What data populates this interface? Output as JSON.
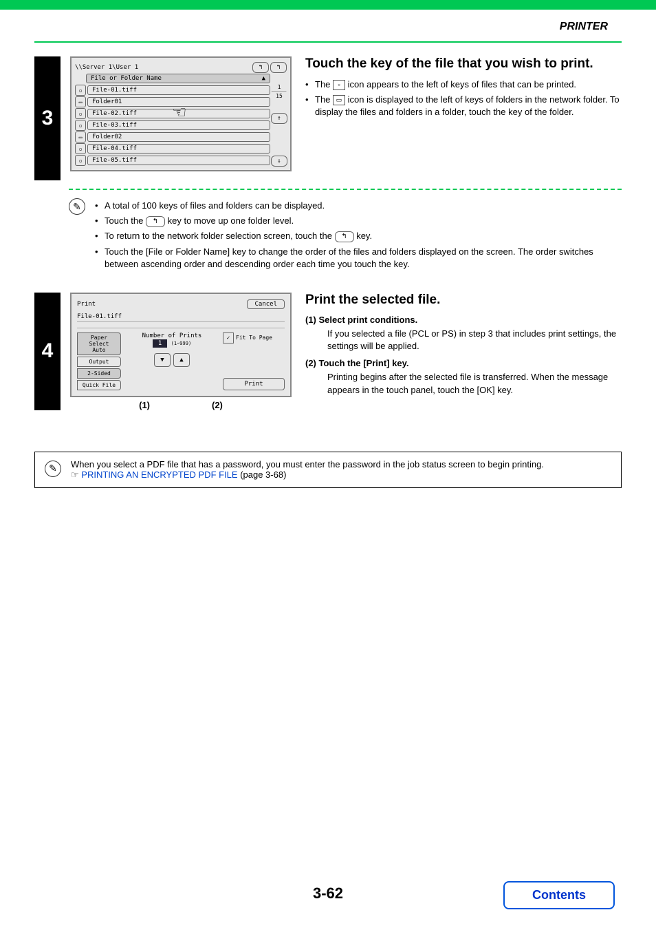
{
  "header": {
    "title": "PRINTER"
  },
  "step3": {
    "number": "3",
    "panel": {
      "path": "\\\\Server 1\\User 1",
      "sort_header": "File or Folder Name",
      "items": [
        {
          "type": "file",
          "name": "File-01.tiff"
        },
        {
          "type": "folder",
          "name": "Folder01"
        },
        {
          "type": "file",
          "name": "File-02.tiff"
        },
        {
          "type": "file",
          "name": "File-03.tiff"
        },
        {
          "type": "folder",
          "name": "Folder02"
        },
        {
          "type": "file",
          "name": "File-04.tiff"
        },
        {
          "type": "file",
          "name": "File-05.tiff"
        }
      ],
      "page_current": "1",
      "page_total": "15"
    },
    "title": "Touch the key of the file that you wish to print.",
    "bullets": [
      {
        "prefix": "The ",
        "mid": " icon appears to the left of keys of files that can be printed."
      },
      {
        "prefix": "The ",
        "mid": " icon is displayed to the left of keys of folders in the network folder. To display the files and folders in a folder, touch the key of the folder."
      }
    ],
    "notes": [
      "A total of 100 keys of files and folders can be displayed.",
      {
        "pre": "Touch the ",
        "post": " key to move up one folder level."
      },
      {
        "pre": "To return to the network folder selection screen, touch the ",
        "post": " key."
      },
      "Touch the [File or Folder Name] key to change the order of the files and folders displayed on the screen. The order switches between ascending order and descending order each time you touch the key."
    ]
  },
  "step4": {
    "number": "4",
    "panel": {
      "title": "Print",
      "cancel": "Cancel",
      "file": "File-01.tiff",
      "tabs": {
        "paper_select": "Paper Select",
        "auto": "Auto",
        "output": "Output",
        "two_sided": "2-Sided",
        "quick_file": "Quick File"
      },
      "number_of_prints": "Number of Prints",
      "prints_value": "1",
      "prints_range": "(1~999)",
      "fit_to_page": "Fit To Page",
      "print_btn": "Print",
      "callout1": "(1)",
      "callout2": "(2)"
    },
    "title": "Print the selected file.",
    "sub1": {
      "label": "(1)  Select print conditions.",
      "text": "If you selected a file (PCL or PS) in step 3 that includes print settings, the settings will be applied."
    },
    "sub2": {
      "label": "(2)  Touch the [Print] key.",
      "text": "Printing begins after the selected file is transferred. When the message appears in the touch panel, touch the [OK] key."
    }
  },
  "encrypted_note": {
    "text": "When you select a PDF file that has a password, you must enter the password in the job status screen to begin printing.",
    "link": "PRINTING AN ENCRYPTED PDF FILE",
    "page_ref": " (page 3-68)"
  },
  "footer": {
    "page": "3-62",
    "contents": "Contents"
  }
}
